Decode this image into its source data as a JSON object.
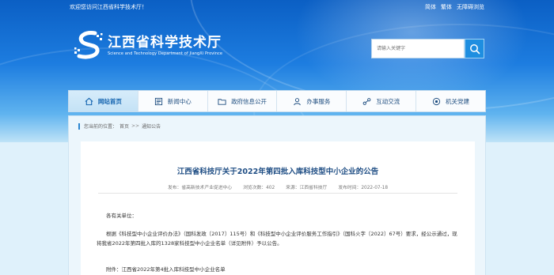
{
  "topbar": {
    "welcome": "欢迎您访问江西省科学技术厅！",
    "links": [
      "简体",
      "繁体",
      "无障碍浏览"
    ]
  },
  "header": {
    "title_cn": "江西省科学技术厅",
    "title_en": "Science and Technology Department of JiangXi Province"
  },
  "search": {
    "placeholder": "请输入关键字"
  },
  "nav": {
    "items": [
      {
        "label": "网站首页",
        "icon": "home-icon"
      },
      {
        "label": "新闻中心",
        "icon": "news-icon"
      },
      {
        "label": "政府信息公开",
        "icon": "folder-icon"
      },
      {
        "label": "办事服务",
        "icon": "person-icon"
      },
      {
        "label": "互动交流",
        "icon": "interact-icon"
      },
      {
        "label": "机关党建",
        "icon": "party-icon"
      }
    ],
    "active_index": 0
  },
  "breadcrumb": {
    "prefix": "您当前的位置：",
    "items": [
      "首页",
      "通知公告"
    ],
    "separator": ">>"
  },
  "article": {
    "title": "江西省科技厅关于2022年第四批入库科技型中小企业的公告",
    "meta": {
      "publisher": "发布：省高新技术产业促进中心",
      "views": "浏览次数：402",
      "source": "来源：江西省科技厅",
      "date": "发布时间：2022-07-18"
    },
    "greeting": "各有关单位：",
    "body": "根据《科技型中小企业评价办法》（国科发政〔2017〕115号）和《科技型中小企业评价服务工作指引》（国科火字〔2022〕67号）要求，经公示通过，现将我省2022年第四批入库的1328家科技型中小企业名单（详见附件）予以公告。",
    "attachment": "附件：江西省2022年第4批入库科技型中小企业名单"
  },
  "colors": {
    "banner_top": "#0b5fc4",
    "accent": "#1e8ee0",
    "title": "#1e4d84"
  }
}
